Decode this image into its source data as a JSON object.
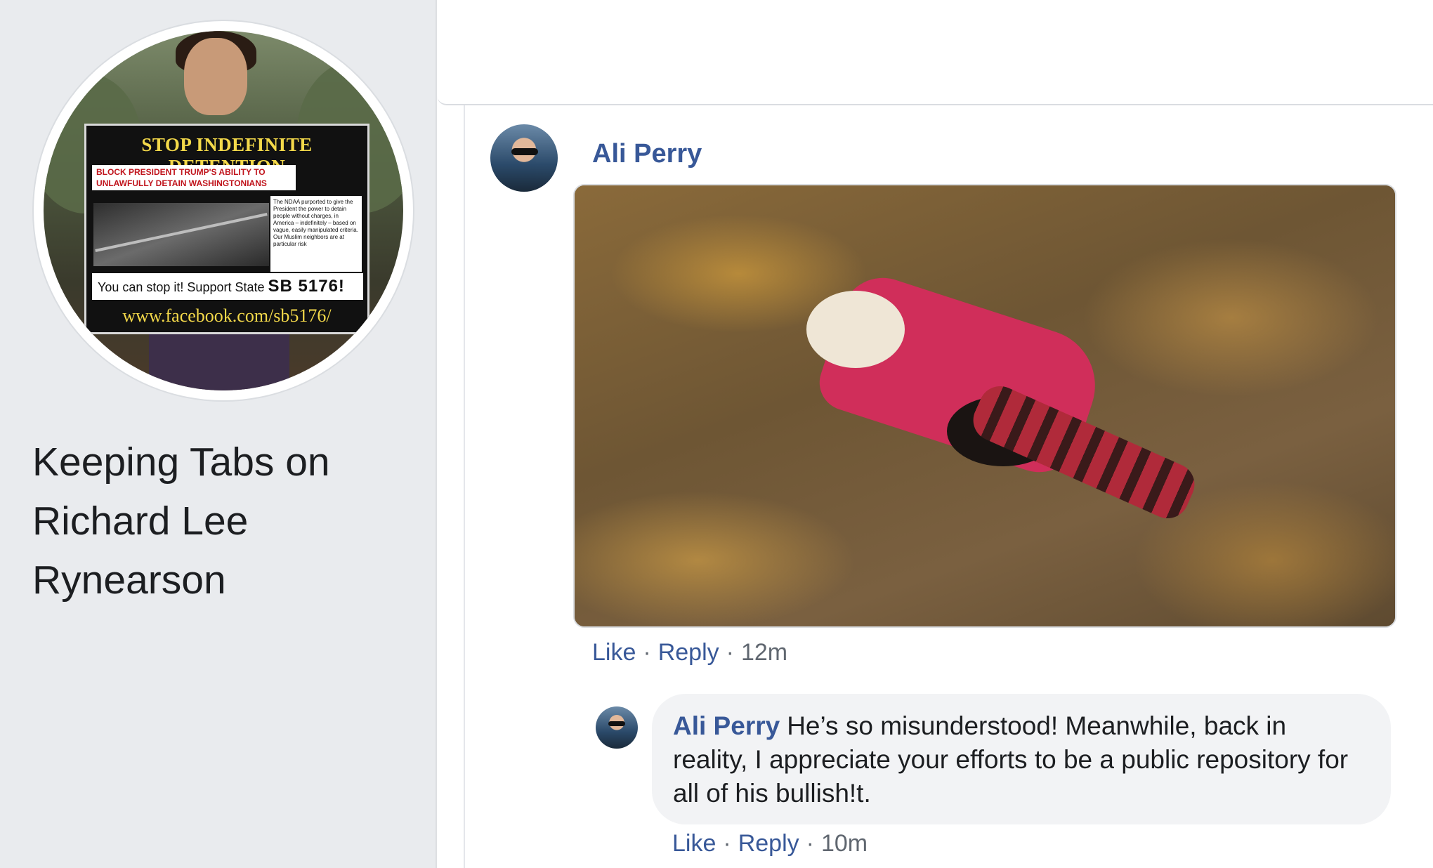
{
  "sidebar": {
    "page_title": "Keeping Tabs on Richard Lee Rynearson",
    "avatar": {
      "sign_title": "STOP INDEFINITE DETENTION",
      "sign_red_text": "BLOCK PRESIDENT TRUMP'S ABILITY TO UNLAWFULLY DETAIN WASHINGTONIANS",
      "sign_note": "The NDAA purported to give the President the power to detain people without charges, in America – indefinitely – based on vague, easily manipulated criteria. Our Muslim neighbors are at particular risk",
      "sign_support_prefix": "You can stop it! Support State",
      "sign_support_bill": "SB 5176!",
      "sign_url": "www.facebook.com/sb5176/"
    }
  },
  "comment": {
    "author": "Ali Perry",
    "actions": {
      "like": "Like",
      "reply": "Reply",
      "sep": "·",
      "time": "12m"
    }
  },
  "reply": {
    "author": "Ali Perry",
    "text": "He’s so misunderstood! Meanwhile, back in reality, I appreciate your efforts to be a public repository for all of his bullish!t.",
    "actions": {
      "like": "Like",
      "reply": "Reply",
      "sep": "·",
      "time": "10m"
    }
  },
  "colors": {
    "link_blue": "#385898",
    "sidebar_bg": "#e9ebee",
    "bubble_bg": "#f2f3f5",
    "meta_gray": "#606770"
  }
}
